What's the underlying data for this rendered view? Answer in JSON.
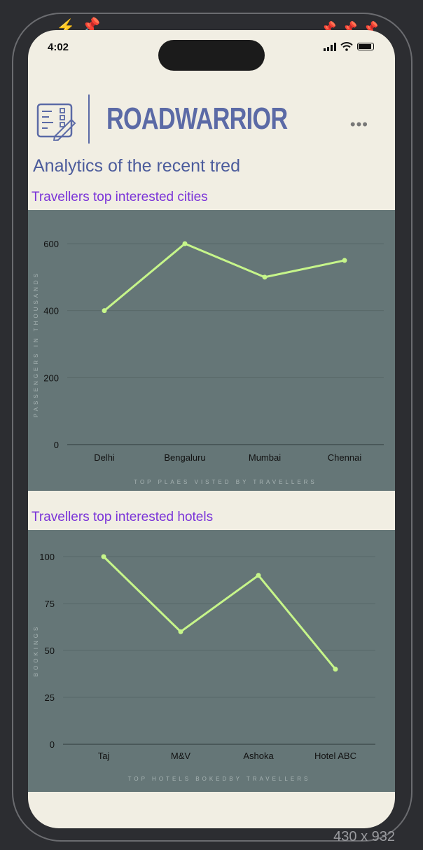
{
  "status_bar": {
    "time": "4:02"
  },
  "app": {
    "name": "ROADWARRIOR",
    "more_label": "•••"
  },
  "page_title": "Analytics of the recent tred",
  "device_dims": "430 x 932",
  "colors": {
    "line": "#c6f58a",
    "chart_bg": "#657677",
    "title": "#4c5c9c",
    "section": "#7a33d8",
    "brand": "#5b6aa6"
  },
  "sections": {
    "cities": {
      "title": "Travellers top interested cities"
    },
    "hotels": {
      "title": "Travellers top interested hotels"
    }
  },
  "chart_data": [
    {
      "type": "line",
      "categories": [
        "Delhi",
        "Bengaluru",
        "Mumbai",
        "Chennai"
      ],
      "values": [
        400,
        600,
        500,
        550
      ],
      "ylabel": "PASSENGERS IN THOUSANDS",
      "xlabel": "TOP PLAES VISTED BY TRAVELLERS",
      "yticks": [
        "0",
        "200",
        "400",
        "600"
      ],
      "ylim": [
        0,
        600
      ]
    },
    {
      "type": "line",
      "categories": [
        "Taj",
        "M&V",
        "Ashoka",
        "Hotel ABC"
      ],
      "values": [
        100,
        60,
        90,
        40
      ],
      "ylabel": "BOOKINGS",
      "xlabel": "TOP HOTELS BOKEDBY TRAVELLERS",
      "yticks": [
        "0",
        "25",
        "50",
        "75",
        "100"
      ],
      "ylim": [
        0,
        100
      ]
    }
  ]
}
